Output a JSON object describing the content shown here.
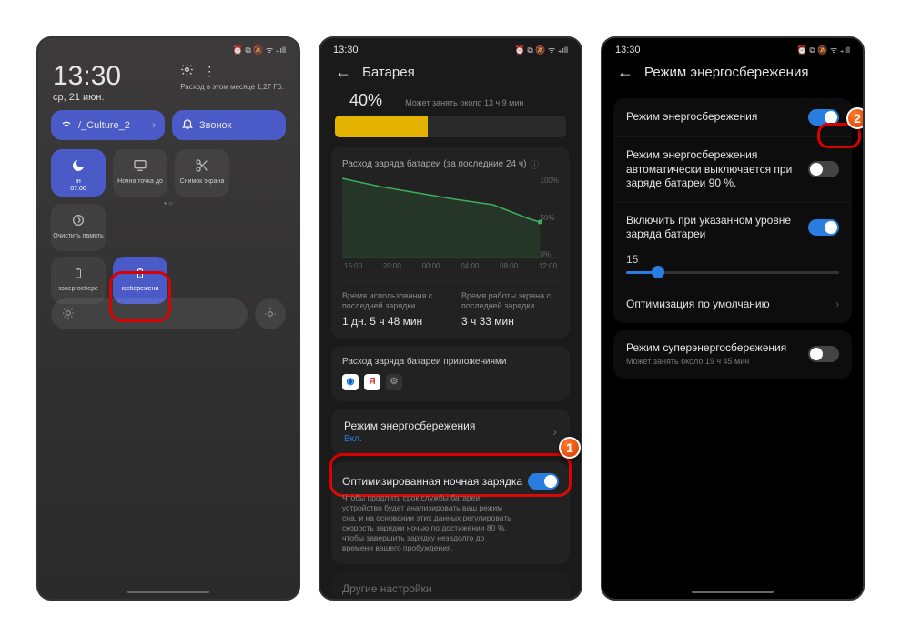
{
  "status": {
    "time": "13:30",
    "icons_text": "⏰ ⧉ 🔕 ᯤ ₊ıll"
  },
  "screen1": {
    "clock": "13:30",
    "date": "ср, 21 июн.",
    "data_usage": "Расход в этом месяце 1,27 ГБ.",
    "wifi_name": "/_Culture_2",
    "ring_label": "Звонок",
    "tiles": [
      {
        "label": "ін",
        "sub": "07:00",
        "on": true,
        "icon": "moon"
      },
      {
        "label": "Ночна точка до",
        "sub": "",
        "on": false,
        "icon": "cast"
      },
      {
        "label": "Снимок экрана",
        "sub": "",
        "on": false,
        "icon": "scissors"
      },
      {
        "label": "Очистить память",
        "sub": "",
        "on": false,
        "icon": "target"
      }
    ],
    "tiles2": [
      {
        "label": "зэнергосбере",
        "on": false,
        "icon": "batt"
      },
      {
        "label": "юсбережени",
        "on": true,
        "icon": "batt"
      }
    ]
  },
  "screen2": {
    "title": "Батарея",
    "percent": "40%",
    "estimate": "Может занять около 13 ч 9 мин",
    "chart_title": "Расход заряда батареи (за последние 24 ч)",
    "x_ticks": [
      "16:00",
      "20:00",
      "00:00",
      "04:00",
      "08:00",
      "12:00"
    ],
    "y_ticks": [
      "100%",
      "50%",
      "0%"
    ],
    "stat1_label": "Время использования с последней зарядки",
    "stat1_value": "1 дн. 5 ч 48 мин",
    "stat2_label": "Время работы экрана с последней зарядки",
    "stat2_value": "3 ч 33 мин",
    "apps_label": "Расход заряда батареи приложениями",
    "mode_title": "Режим энергосбережения",
    "mode_sub": "Вкл.",
    "night_title": "Оптимизированная ночная зарядка",
    "night_desc": "Чтобы продлить срок службы батареи, устройство будет анализировать ваш режим сна, и на основании этих данных регулировать скорость зарядки ночью по достижении 80 %, чтобы завершить зарядку незадолго до времени вашего пробуждения.",
    "other": "Другие настройки",
    "badge1": "1"
  },
  "screen3": {
    "title": "Режим энергосбережения",
    "row1": "Режим энергосбережения",
    "row2": "Режим энергосбережения автоматически выключается при заряде батареи 90 %.",
    "row3": "Включить при указанном уровне заряда батареи",
    "slider_value": "15",
    "row4": "Оптимизация по умолчанию",
    "row5": "Режим суперэнергосбережения",
    "row5_sub": "Может занять около 19 ч 45 мин",
    "badge2": "2"
  },
  "chart_data": {
    "type": "line",
    "title": "Расход заряда батареи (за последние 24 ч)",
    "xlabel": "",
    "ylabel": "",
    "x": [
      "16:00",
      "20:00",
      "00:00",
      "04:00",
      "08:00",
      "12:00"
    ],
    "y": [
      98,
      88,
      80,
      72,
      66,
      48
    ],
    "ylim": [
      0,
      100
    ],
    "series": [
      {
        "name": "battery_percent",
        "values": [
          98,
          88,
          80,
          72,
          66,
          48
        ]
      }
    ]
  }
}
